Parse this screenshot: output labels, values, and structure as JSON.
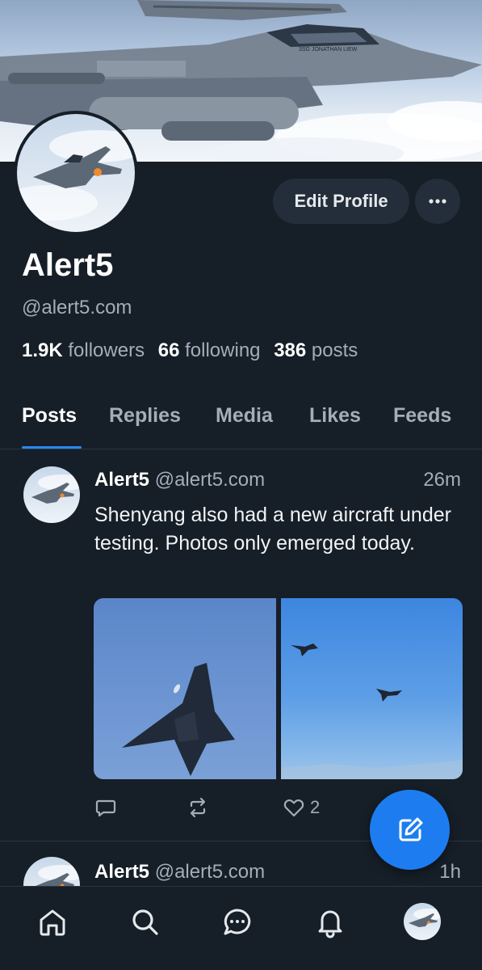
{
  "profile": {
    "display_name": "Alert5",
    "handle": "@alert5.com",
    "edit_label": "Edit Profile",
    "more_label": "•••",
    "followers_count": "1.9K",
    "followers_label": "followers",
    "following_count": "66",
    "following_label": "following",
    "posts_count": "386",
    "posts_label": "posts",
    "banner_text": "3SG JONATHAN LIEW"
  },
  "tabs": [
    {
      "label": "Posts",
      "active": true
    },
    {
      "label": "Replies",
      "active": false
    },
    {
      "label": "Media",
      "active": false
    },
    {
      "label": "Likes",
      "active": false
    },
    {
      "label": "Feeds",
      "active": false
    }
  ],
  "posts": [
    {
      "author": "Alert5",
      "handle": "@alert5.com",
      "time": "26m",
      "text": "Shenyang also had a new aircraft under testing. Photos only emerged today.",
      "replies": "",
      "reposts": "",
      "likes": "2"
    },
    {
      "author": "Alert5",
      "handle": "@alert5.com",
      "time": "1h"
    }
  ],
  "nav": {
    "items": [
      "home-icon",
      "search-icon",
      "chat-icon",
      "bell-icon",
      "profile-avatar"
    ]
  },
  "colors": {
    "background": "#161e27",
    "accent": "#1d7df0",
    "muted_text": "#a4adb8",
    "button_bg": "#242e3a"
  }
}
